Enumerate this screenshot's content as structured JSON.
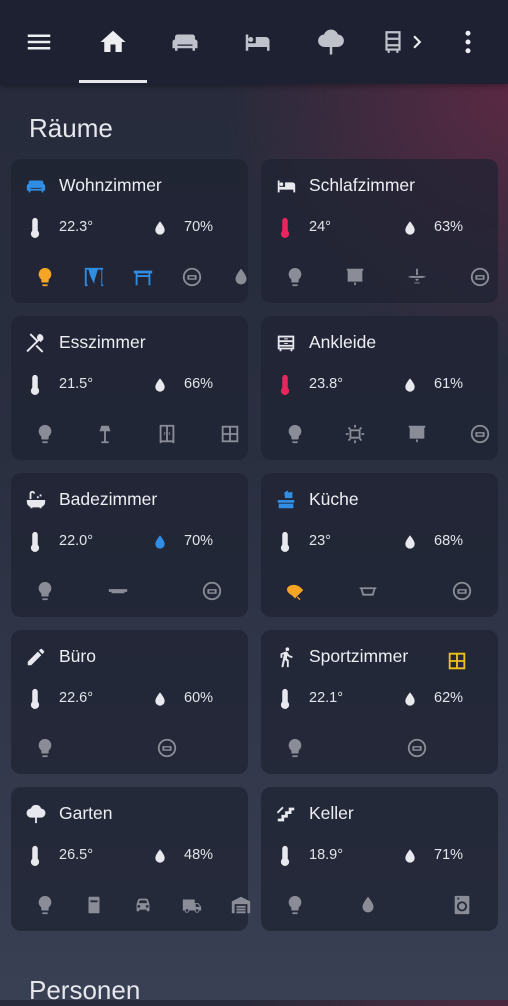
{
  "colors": {
    "accent_blue": "#2f8de4",
    "thermo_red": "#e8265e",
    "bulb_orange": "#f5a524",
    "window_yellow": "#f1c21b",
    "icon_gray": "#8a8d98",
    "text": "#eceef2"
  },
  "header": {
    "icons": [
      "menu-icon",
      "home-icon",
      "sofa-icon",
      "bed-icon",
      "tree-icon",
      "wardrobe-icon",
      "chevron-right-icon",
      "more-vert-icon"
    ],
    "active_tab": "home"
  },
  "section_rooms": "Räume",
  "section_persons": "Personen",
  "rooms": [
    {
      "name": "Wohnzimmer",
      "icon": "sofa-icon",
      "icon_color": "#2f8de4",
      "temp": "22.3°",
      "temp_icon_color": "#e8e9ee",
      "hum": "70%",
      "hum_icon_color": "#e8e9ee",
      "devices": [
        {
          "icon": "bulb-icon",
          "color": "#f5a524"
        },
        {
          "icon": "curtains-icon",
          "color": "#2f8de4"
        },
        {
          "icon": "table-icon",
          "color": "#2f8de4"
        },
        {
          "icon": "robot-vacuum-icon",
          "color": "#8a8d98"
        },
        {
          "icon": "water-drop-icon",
          "color": "#8a8d98"
        }
      ]
    },
    {
      "name": "Schlafzimmer",
      "icon": "bed-icon",
      "icon_color": "#e8e9ee",
      "temp": "24°",
      "temp_icon_color": "#e8265e",
      "hum": "63%",
      "hum_icon_color": "#e8e9ee",
      "devices": [
        {
          "icon": "bulb-icon",
          "color": "#8a8d98"
        },
        {
          "icon": "blinds-icon",
          "color": "#8a8d98"
        },
        {
          "icon": "ceiling-fan-icon",
          "color": "#8a8d98"
        },
        {
          "icon": "robot-vacuum-icon",
          "color": "#8a8d98"
        }
      ]
    },
    {
      "name": "Esszimmer",
      "icon": "utensils-icon",
      "icon_color": "#e8e9ee",
      "temp": "21.5°",
      "temp_icon_color": "#e8e9ee",
      "hum": "66%",
      "hum_icon_color": "#e8e9ee",
      "devices": [
        {
          "icon": "bulb-icon",
          "color": "#8a8d98"
        },
        {
          "icon": "floor-lamp-icon",
          "color": "#8a8d98"
        },
        {
          "icon": "cabinet-icon",
          "color": "#8a8d98"
        },
        {
          "icon": "window-icon",
          "color": "#8a8d98"
        }
      ]
    },
    {
      "name": "Ankleide",
      "icon": "wardrobe-icon",
      "icon_color": "#e8e9ee",
      "temp": "23.8°",
      "temp_icon_color": "#e8265e",
      "hum": "61%",
      "hum_icon_color": "#e8e9ee",
      "devices": [
        {
          "icon": "bulb-icon",
          "color": "#8a8d98"
        },
        {
          "icon": "led-strip-icon",
          "color": "#8a8d98"
        },
        {
          "icon": "blinds-icon",
          "color": "#8a8d98"
        },
        {
          "icon": "robot-vacuum-icon",
          "color": "#8a8d98"
        }
      ]
    },
    {
      "name": "Badezimmer",
      "icon": "bathtub-icon",
      "icon_color": "#e8e9ee",
      "temp": "22.0°",
      "temp_icon_color": "#e8e9ee",
      "hum": "70%",
      "hum_icon_color": "#2f8de4",
      "devices": [
        {
          "icon": "bulb-icon",
          "color": "#8a8d98"
        },
        {
          "icon": "light-bar-icon",
          "color": "#8a8d98"
        },
        {
          "icon": "robot-vacuum-icon",
          "color": "#8a8d98"
        }
      ]
    },
    {
      "name": "Küche",
      "icon": "kitchen-icon",
      "icon_color": "#2f8de4",
      "temp": "23°",
      "temp_icon_color": "#e8e9ee",
      "hum": "68%",
      "hum_icon_color": "#e8e9ee",
      "devices": [
        {
          "icon": "spotlight-icon",
          "color": "#f5a524"
        },
        {
          "icon": "sink-light-icon",
          "color": "#8a8d98"
        },
        {
          "icon": "robot-vacuum-icon",
          "color": "#8a8d98"
        }
      ]
    },
    {
      "name": "Büro",
      "icon": "pencil-icon",
      "icon_color": "#e8e9ee",
      "temp": "22.6°",
      "temp_icon_color": "#e8e9ee",
      "hum": "60%",
      "hum_icon_color": "#e8e9ee",
      "devices": [
        {
          "icon": "bulb-icon",
          "color": "#8a8d98"
        },
        {
          "icon": "robot-vacuum-icon",
          "color": "#8a8d98"
        }
      ]
    },
    {
      "name": "Sportzimmer",
      "icon": "running-icon",
      "icon_color": "#e8e9ee",
      "temp": "22.1°",
      "temp_icon_color": "#e8e9ee",
      "hum": "62%",
      "hum_icon_color": "#e8e9ee",
      "extra_icon": "window-icon",
      "extra_color": "#f1c21b",
      "devices": [
        {
          "icon": "bulb-icon",
          "color": "#8a8d98"
        },
        {
          "icon": "robot-vacuum-icon",
          "color": "#8a8d98"
        }
      ]
    },
    {
      "name": "Garten",
      "icon": "tree-icon",
      "icon_color": "#e8e9ee",
      "temp": "26.5°",
      "temp_icon_color": "#e8e9ee",
      "hum": "48%",
      "hum_icon_color": "#e8e9ee",
      "devices": [
        {
          "icon": "bulb-icon",
          "color": "#8a8d98"
        },
        {
          "icon": "bin-icon",
          "color": "#8a8d98"
        },
        {
          "icon": "car-icon",
          "color": "#8a8d98"
        },
        {
          "icon": "van-icon",
          "color": "#8a8d98"
        },
        {
          "icon": "garage-icon",
          "color": "#8a8d98"
        }
      ]
    },
    {
      "name": "Keller",
      "icon": "stairs-icon",
      "icon_color": "#e8e9ee",
      "temp": "18.9°",
      "temp_icon_color": "#e8e9ee",
      "hum": "71%",
      "hum_icon_color": "#e8e9ee",
      "devices": [
        {
          "icon": "bulb-icon",
          "color": "#8a8d98"
        },
        {
          "icon": "water-drop-icon",
          "color": "#8a8d98"
        },
        {
          "icon": "washing-machine-icon",
          "color": "#8a8d98"
        }
      ]
    }
  ]
}
